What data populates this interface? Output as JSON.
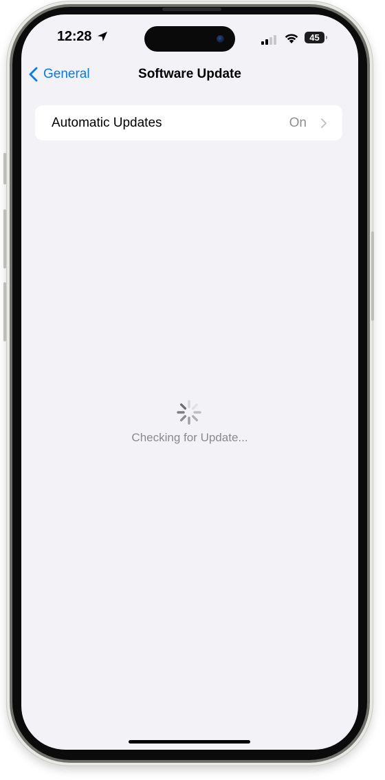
{
  "status_bar": {
    "time": "12:28",
    "battery_level": "45",
    "location_icon": "location-arrow-icon",
    "signal_icon": "cellular-signal-icon",
    "wifi_icon": "wifi-icon"
  },
  "nav": {
    "back_label": "General",
    "title": "Software Update"
  },
  "settings": {
    "rows": [
      {
        "label": "Automatic Updates",
        "value": "On"
      }
    ]
  },
  "loading": {
    "text": "Checking for Update..."
  },
  "colors": {
    "accent": "#007aff",
    "background": "#f2f2f7",
    "secondary_text": "#8e8e93"
  }
}
